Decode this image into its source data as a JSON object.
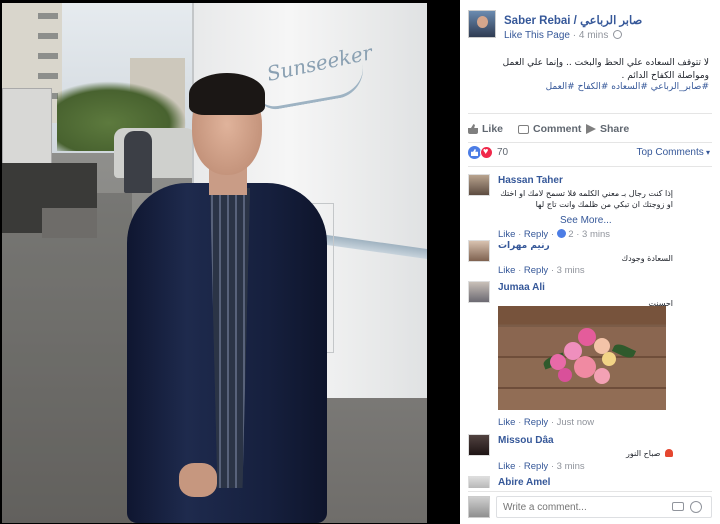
{
  "post": {
    "page_name": "Saber Rebai / صابر الرباعي",
    "like_page": "Like This Page",
    "time": "4 mins",
    "caption": "لا تتوقف السعاده علي الحظ والبخت .. وإنما علي العمل ومواصلة الكفاح الدائم .",
    "hashtags": "#صابر_الرباعي #السعاده #الكفاح #العمل",
    "photo_brand": "Sunseeker"
  },
  "actions": {
    "like": "Like",
    "comment": "Comment",
    "share": "Share"
  },
  "reactions": {
    "count": "70",
    "sort": "Top Comments"
  },
  "comments": [
    {
      "name": "Hassan Taher",
      "text": "إذا كنت رجال بـ معني الكلمه فلا تسمح لامك او اختك او زوجتك ان تبكي من ظلمك وانت تاج لها",
      "see_more": "See More...",
      "like": "Like",
      "reply": "Reply",
      "replies": "2",
      "time": "3 mins"
    },
    {
      "name": "رنيم مهرات",
      "text": "السعادة وجودك",
      "like": "Like",
      "reply": "Reply",
      "time": "3 mins"
    },
    {
      "name": "Jumaa Ali",
      "text": "احسنت",
      "like": "Like",
      "reply": "Reply",
      "time": "Just now"
    },
    {
      "name": "Missou Dâa",
      "text": "صباح النور",
      "like": "Like",
      "reply": "Reply",
      "time": "3 mins"
    },
    {
      "name": "Abire Amel"
    }
  ],
  "composer": {
    "placeholder": "Write a comment..."
  },
  "icons": [
    "like-icon",
    "comment-icon",
    "share-icon",
    "globe-icon",
    "camera-icon",
    "emoji-icon"
  ],
  "colors": {
    "link": "#365899",
    "like_reaction": "#4c7de5",
    "love_reaction": "#f0284a"
  }
}
